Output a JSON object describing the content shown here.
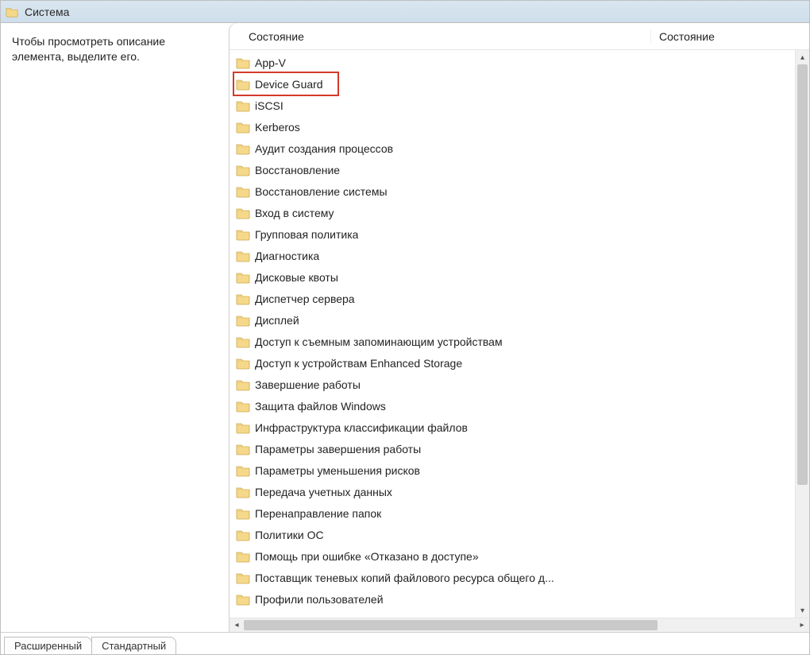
{
  "titlebar": {
    "title": "Система"
  },
  "left_pane": {
    "hint": "Чтобы просмотреть описание элемента, выделите его."
  },
  "columns": {
    "col1": "Состояние",
    "col2": "Состояние"
  },
  "items": [
    {
      "label": "App-V"
    },
    {
      "label": "Device Guard",
      "highlighted": true
    },
    {
      "label": "iSCSI"
    },
    {
      "label": "Kerberos"
    },
    {
      "label": "Аудит создания процессов"
    },
    {
      "label": "Восстановление"
    },
    {
      "label": "Восстановление системы"
    },
    {
      "label": "Вход в систему"
    },
    {
      "label": "Групповая политика"
    },
    {
      "label": "Диагностика"
    },
    {
      "label": "Дисковые квоты"
    },
    {
      "label": "Диспетчер сервера"
    },
    {
      "label": "Дисплей"
    },
    {
      "label": "Доступ к съемным запоминающим устройствам"
    },
    {
      "label": "Доступ к устройствам Enhanced Storage"
    },
    {
      "label": "Завершение работы"
    },
    {
      "label": "Защита файлов Windows"
    },
    {
      "label": "Инфраструктура классификации файлов"
    },
    {
      "label": "Параметры завершения работы"
    },
    {
      "label": "Параметры уменьшения рисков"
    },
    {
      "label": "Передача учетных данных"
    },
    {
      "label": "Перенаправление папок"
    },
    {
      "label": "Политики ОС"
    },
    {
      "label": "Помощь при ошибке «Отказано в доступе»"
    },
    {
      "label": "Поставщик теневых копий файлового ресурса общего д..."
    },
    {
      "label": "Профили пользователей"
    }
  ],
  "tabs": {
    "extended": "Расширенный",
    "standard": "Стандартный"
  }
}
